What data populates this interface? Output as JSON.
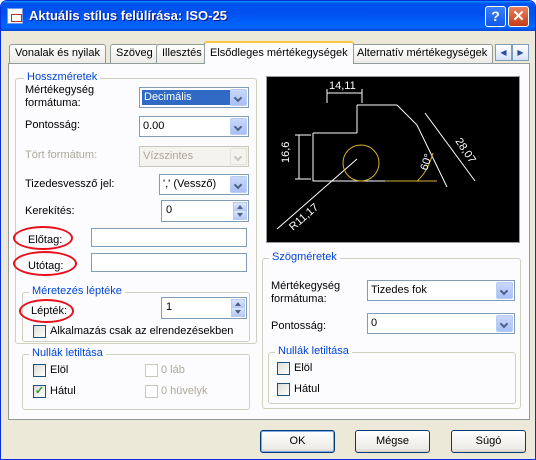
{
  "window": {
    "title": "Aktuális stílus felülírása: ISO-25",
    "help": "?",
    "close": "✕"
  },
  "tabs": [
    "Vonalak és nyilak",
    "Szöveg",
    "Illesztés",
    "Elsődleges mértékegységek",
    "Alternatív mértékegységek"
  ],
  "active_tab": "Elsődleges mértékegységek",
  "linear": {
    "group_title": "Hosszméretek",
    "unit_format_label": "Mértékegység\nformátuma:",
    "unit_format_value": "Decimális",
    "precision_label": "Pontosság:",
    "precision_value": "0.00",
    "fraction_label": "Tört formátum:",
    "fraction_value": "Vízszintes",
    "decimal_sep_label": "Tizedesvessző jel:",
    "decimal_sep_value": "',' (Vessző)",
    "roundoff_label": "Kerekítés:",
    "roundoff_value": "0",
    "prefix_label": "Előtag:",
    "prefix_value": "",
    "suffix_label": "Utótag:",
    "suffix_value": ""
  },
  "scale": {
    "group_title": "Méretezés léptéke",
    "factor_label": "Lépték:",
    "factor_value": "1",
    "layout_only_label": "Alkalmazás csak az elrendezésekben",
    "layout_only_checked": false
  },
  "linear_zero": {
    "group_title": "Nullák letiltása",
    "leading": {
      "label": "Elöl",
      "checked": false
    },
    "trailing": {
      "label": "Hátul",
      "checked": true
    },
    "feet": {
      "label": "0 láb",
      "checked": false
    },
    "inches": {
      "label": "0 hüvelyk",
      "checked": false
    }
  },
  "preview": {
    "dim_top": "14,11",
    "dim_left": "16,6",
    "dim_diag": "28,07",
    "dim_angle": "60°",
    "dim_radius": "R11,17",
    "line_color": "#ffffff",
    "arc_color": "#d8b030"
  },
  "angular": {
    "group_title": "Szögméretek",
    "unit_format_label": "Mértékegység\nformátuma:",
    "unit_format_value": "Tizedes fok",
    "precision_label": "Pontosság:",
    "precision_value": "0"
  },
  "angular_zero": {
    "group_title": "Nullák letiltása",
    "leading": {
      "label": "Elöl",
      "checked": false
    },
    "trailing": {
      "label": "Hátul",
      "checked": false
    }
  },
  "buttons": {
    "ok": "OK",
    "cancel": "Mégse",
    "help": "Súgó"
  },
  "colors": {
    "title_bar": "#0054e3",
    "group_title": "#0046d5",
    "annotation_ring": "#e8101a",
    "selection": "#316ac5"
  }
}
